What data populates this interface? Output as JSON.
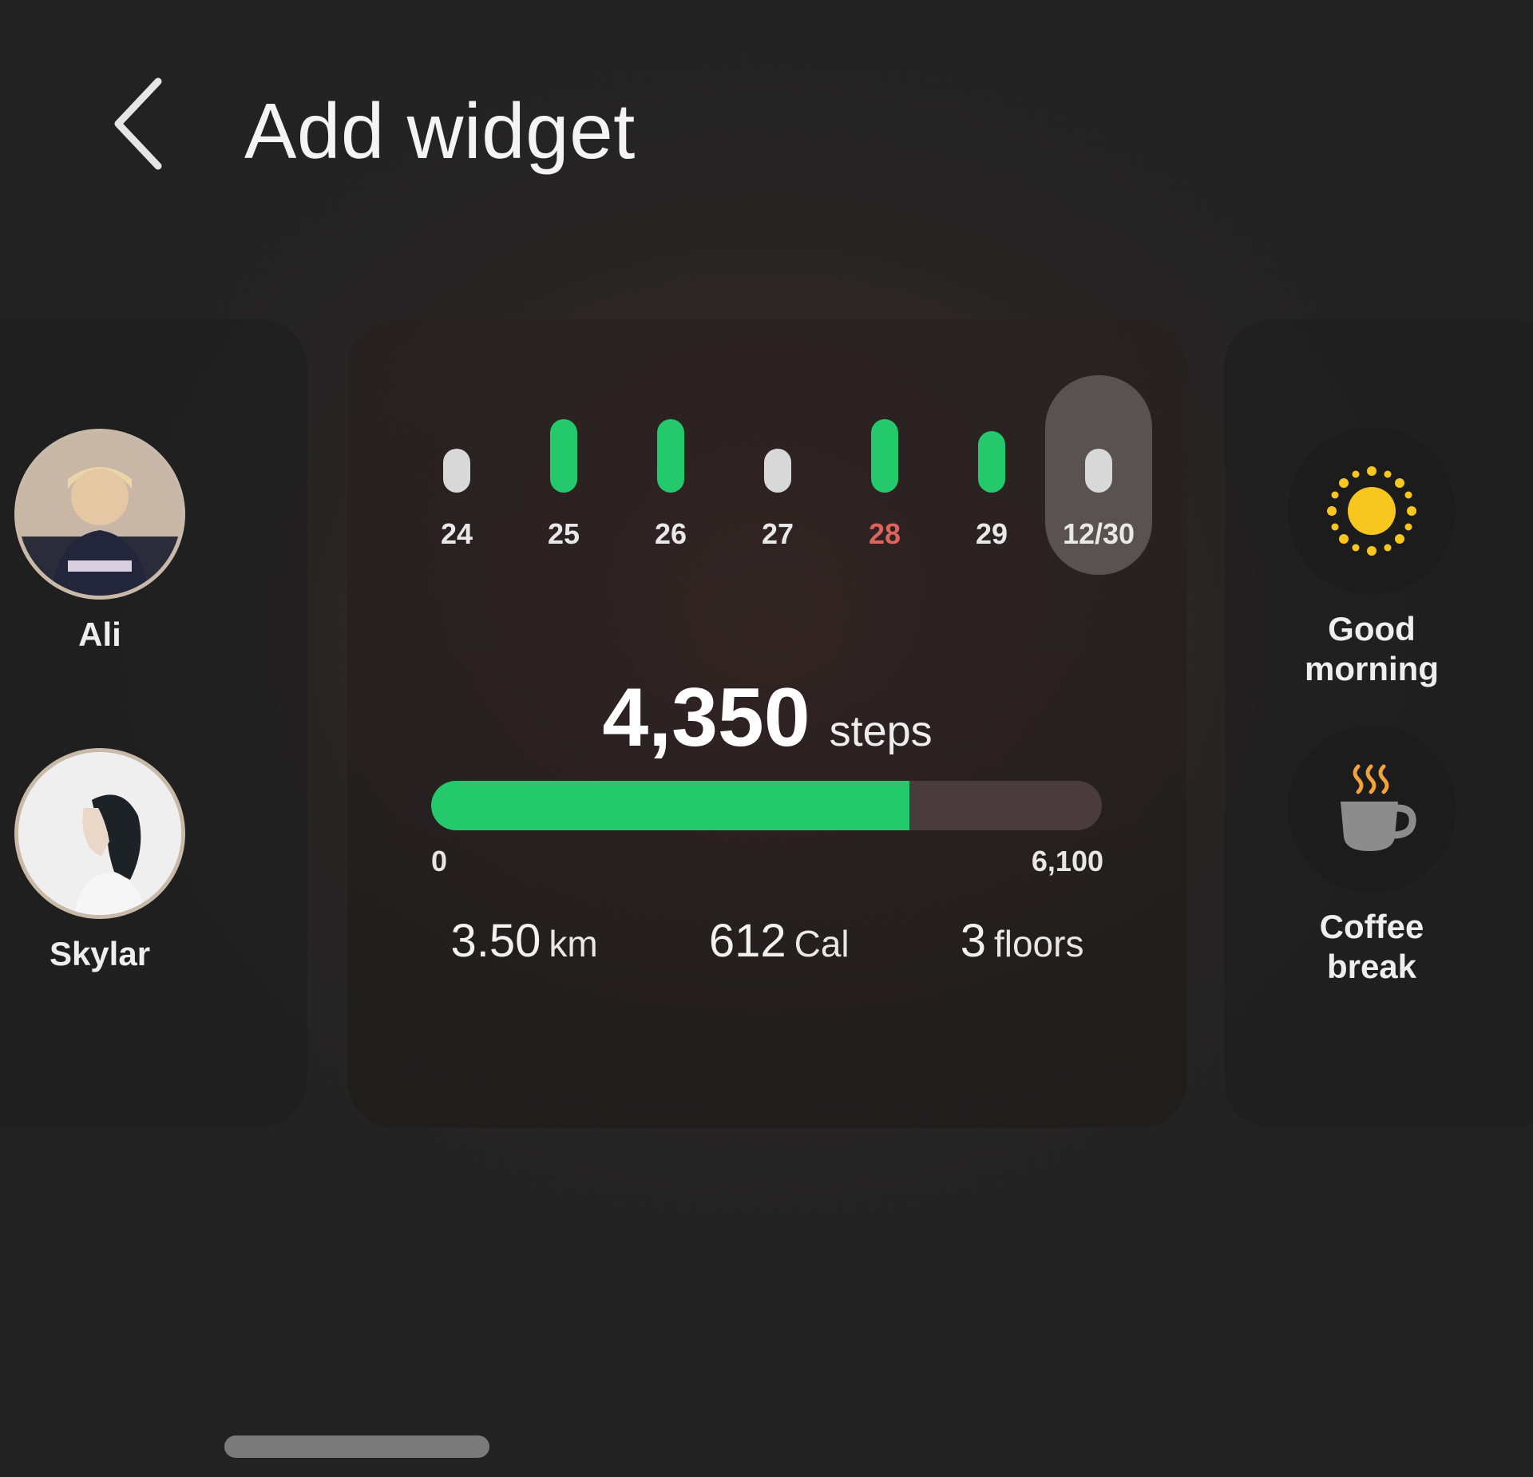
{
  "header": {
    "title": "Add widget"
  },
  "contacts": [
    {
      "name": "Ali"
    },
    {
      "name": "Skylar"
    }
  ],
  "steps_widget": {
    "days": [
      {
        "label": "24",
        "goal_met": false,
        "label_color": "#e8e8e8"
      },
      {
        "label": "25",
        "goal_met": true,
        "label_color": "#e8e8e8"
      },
      {
        "label": "26",
        "goal_met": true,
        "label_color": "#e8e8e8"
      },
      {
        "label": "27",
        "goal_met": false,
        "label_color": "#e8e8e8"
      },
      {
        "label": "28",
        "goal_met": true,
        "label_color": "#d9655c"
      },
      {
        "label": "29",
        "goal_met": true,
        "label_color": "#e8e8e8"
      },
      {
        "label": "12/30",
        "goal_met": false,
        "label_color": "#e8e8e8",
        "selected": true
      }
    ],
    "steps": "4,350",
    "steps_unit": "steps",
    "progress_fraction": 0.713,
    "scale_min": "0",
    "scale_max": "6,100",
    "stats": [
      {
        "value": "3.50",
        "unit": "km"
      },
      {
        "value": "612",
        "unit": "Cal"
      },
      {
        "value": "3",
        "unit": "floors"
      }
    ],
    "colors": {
      "goal_met": "#23c96a",
      "goal_not_met": "#d8d8d8",
      "track": "#4a3c3c"
    }
  },
  "routines": [
    {
      "label_line1": "Good",
      "label_line2": "morning",
      "icon": "sun-icon"
    },
    {
      "label_line1": "Coffee",
      "label_line2": "break",
      "icon": "coffee-cup-icon"
    }
  ]
}
